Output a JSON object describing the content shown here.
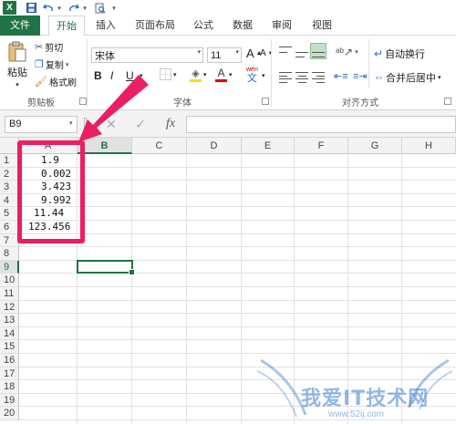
{
  "quick_access": {
    "undo_icon": "undo-icon",
    "redo_icon": "redo-icon"
  },
  "tabs": [
    {
      "label": "文件"
    },
    {
      "label": "开始"
    },
    {
      "label": "插入"
    },
    {
      "label": "页面布局"
    },
    {
      "label": "公式"
    },
    {
      "label": "数据"
    },
    {
      "label": "审阅"
    },
    {
      "label": "视图"
    }
  ],
  "ribbon": {
    "clipboard": {
      "paste_label": "粘贴",
      "cut_label": "剪切",
      "copy_label": "复制",
      "format_painter_label": "格式刷",
      "group_label": "剪贴板"
    },
    "font": {
      "font_name": "宋体",
      "font_size": "11",
      "bold": "B",
      "italic": "I",
      "underline": "U",
      "grow": "A",
      "shrink": "A",
      "font_color_glyph": "A",
      "wen": "wén",
      "wen_char": "文",
      "group_label": "字体"
    },
    "alignment": {
      "wrap_text_label": "自动换行",
      "merge_center_label": "合并后居中",
      "group_label": "对齐方式"
    }
  },
  "formula_bar": {
    "name_box": "B9",
    "fx_label": "fx",
    "content": ""
  },
  "sheet": {
    "columns": [
      "A",
      "B",
      "C",
      "D",
      "E",
      "F",
      "G",
      "H"
    ],
    "rows": [
      "1",
      "2",
      "3",
      "4",
      "5",
      "6",
      "7",
      "8",
      "9",
      "10",
      "11",
      "12",
      "13",
      "14",
      "15",
      "16",
      "17",
      "18",
      "19",
      "20"
    ],
    "column_a_values": [
      "1.9",
      "0.002",
      "3.423",
      "9.992",
      "11.44",
      "123.456"
    ],
    "selected_cell": "B9"
  },
  "watermark": {
    "text": "我爱IT技术网",
    "url": "www.52ij.com"
  },
  "colors": {
    "accent": "#217346",
    "annotation": "#e91e63"
  }
}
